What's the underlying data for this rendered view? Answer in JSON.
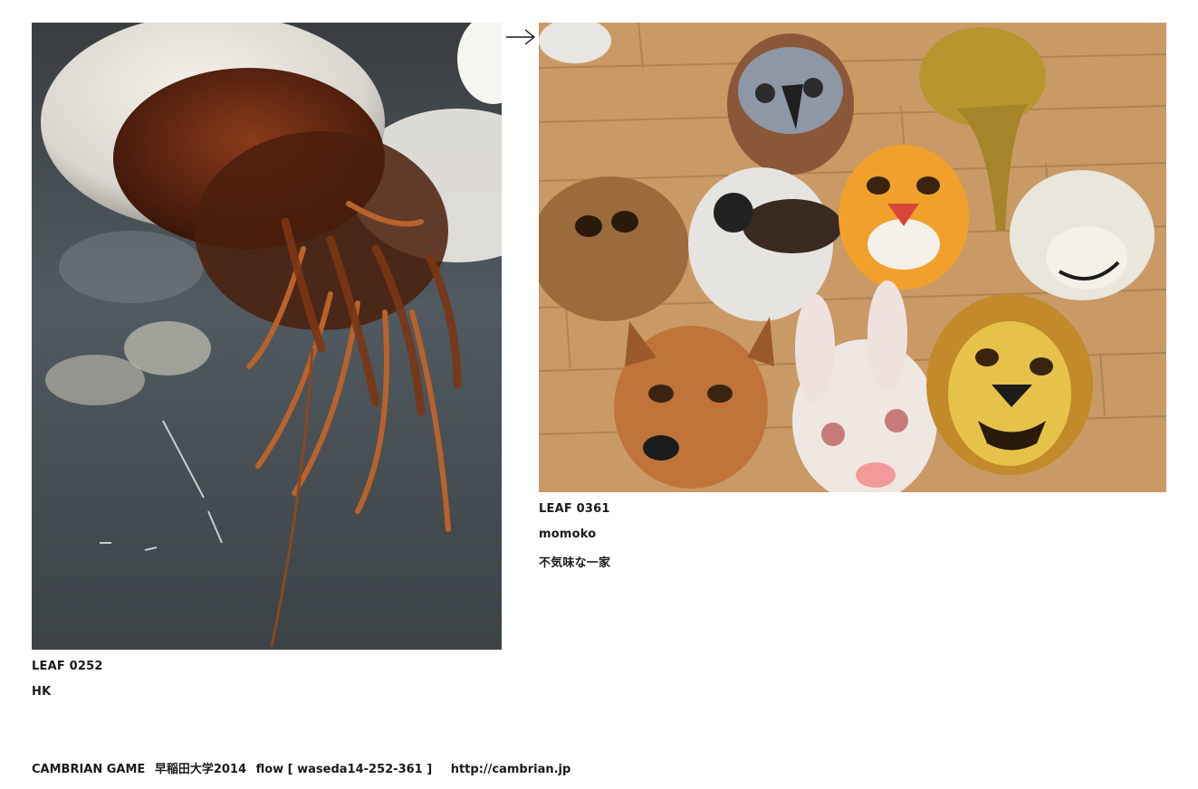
{
  "entries": [
    {
      "id": "LEAF 0252",
      "author": "HK",
      "title": "",
      "subject": "jellyfish-photo"
    },
    {
      "id": "LEAF 0361",
      "author": "momoko",
      "title": "不気味な一家",
      "subject": "animal-masks-photo"
    }
  ],
  "nav": {
    "next_icon": "arrow-right-icon"
  },
  "footer": {
    "brand": "CAMBRIAN GAME",
    "event": "早稲田大学2014",
    "flow": "flow [ waseda14-252-361 ]",
    "url": "http://cambrian.jp"
  },
  "colors": {
    "text": "#1a1a1a",
    "background": "#ffffff"
  }
}
